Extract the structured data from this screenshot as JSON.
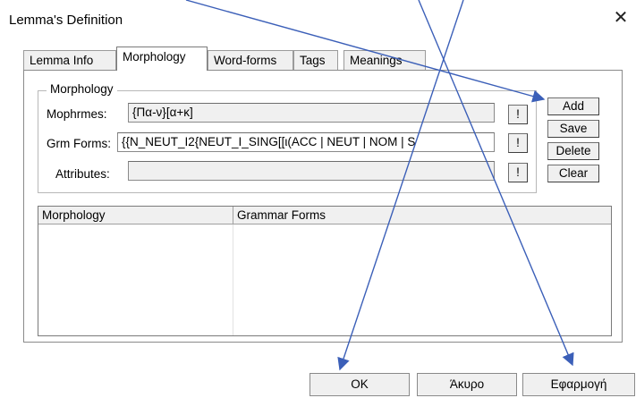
{
  "window": {
    "title": "Lemma's Definition",
    "close_glyph": "✕"
  },
  "tabs": [
    {
      "label": "Lemma Info",
      "active": false
    },
    {
      "label": "Morphology",
      "active": true
    },
    {
      "label": "Word-forms",
      "active": false
    },
    {
      "label": "Tags",
      "active": false
    },
    {
      "label": "Meanings",
      "active": false
    }
  ],
  "morphology": {
    "group_label": "Morphology",
    "morphemes": {
      "label": "Mophrmes:",
      "value": "{Πα-ν}[α+κ]"
    },
    "grm_forms": {
      "label": "Grm Forms:",
      "value": "{{N_NEUT_I2{NEUT_I_SING[[ι(ACC | NEUT | NOM | S"
    },
    "attributes": {
      "label": "Attributes:",
      "value": ""
    },
    "exclaim_label": "!",
    "buttons": {
      "add": "Add",
      "save": "Save",
      "delete": "Delete",
      "clear": "Clear"
    }
  },
  "list": {
    "columns": [
      "Morphology",
      "Grammar Forms"
    ]
  },
  "footer": {
    "ok": "OK",
    "cancel": "Άκυρο",
    "apply": "Εφαρμογή"
  },
  "colors": {
    "annotation_arrow": "#3b5fb8"
  }
}
